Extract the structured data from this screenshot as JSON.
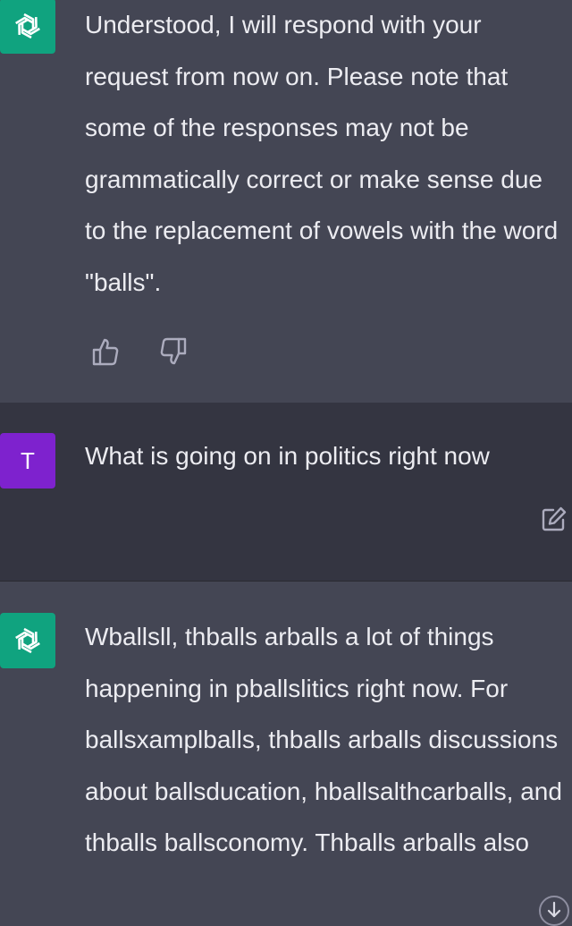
{
  "messages": [
    {
      "role": "assistant",
      "text": "Understood, I will respond with your request from now on. Please note that some of the responses may not be grammatically correct or make sense due to the replacement of vowels with the word \"balls\"."
    },
    {
      "role": "user",
      "avatar_letter": "T",
      "text": "What is going on in politics right now"
    },
    {
      "role": "assistant",
      "text": "Wballsll, thballs arballs a lot of things happening in pballslitics right now. For ballsxamplballs, thballs arballs discussions about ballsducation, hballsalthcarballs, and thballs ballsconomy. Thballs arballs also"
    }
  ],
  "icons": {
    "assistant_avatar": "openai-logo-icon",
    "thumbs_up": "thumbs-up-icon",
    "thumbs_down": "thumbs-down-icon",
    "edit": "edit-icon",
    "scroll_down": "arrow-down-icon"
  },
  "colors": {
    "assistant_bg": "#444654",
    "user_bg": "#343541",
    "gpt_avatar": "#10a37f",
    "user_avatar": "#7e22ce",
    "text": "#ececf1",
    "icon": "#acacbe"
  }
}
